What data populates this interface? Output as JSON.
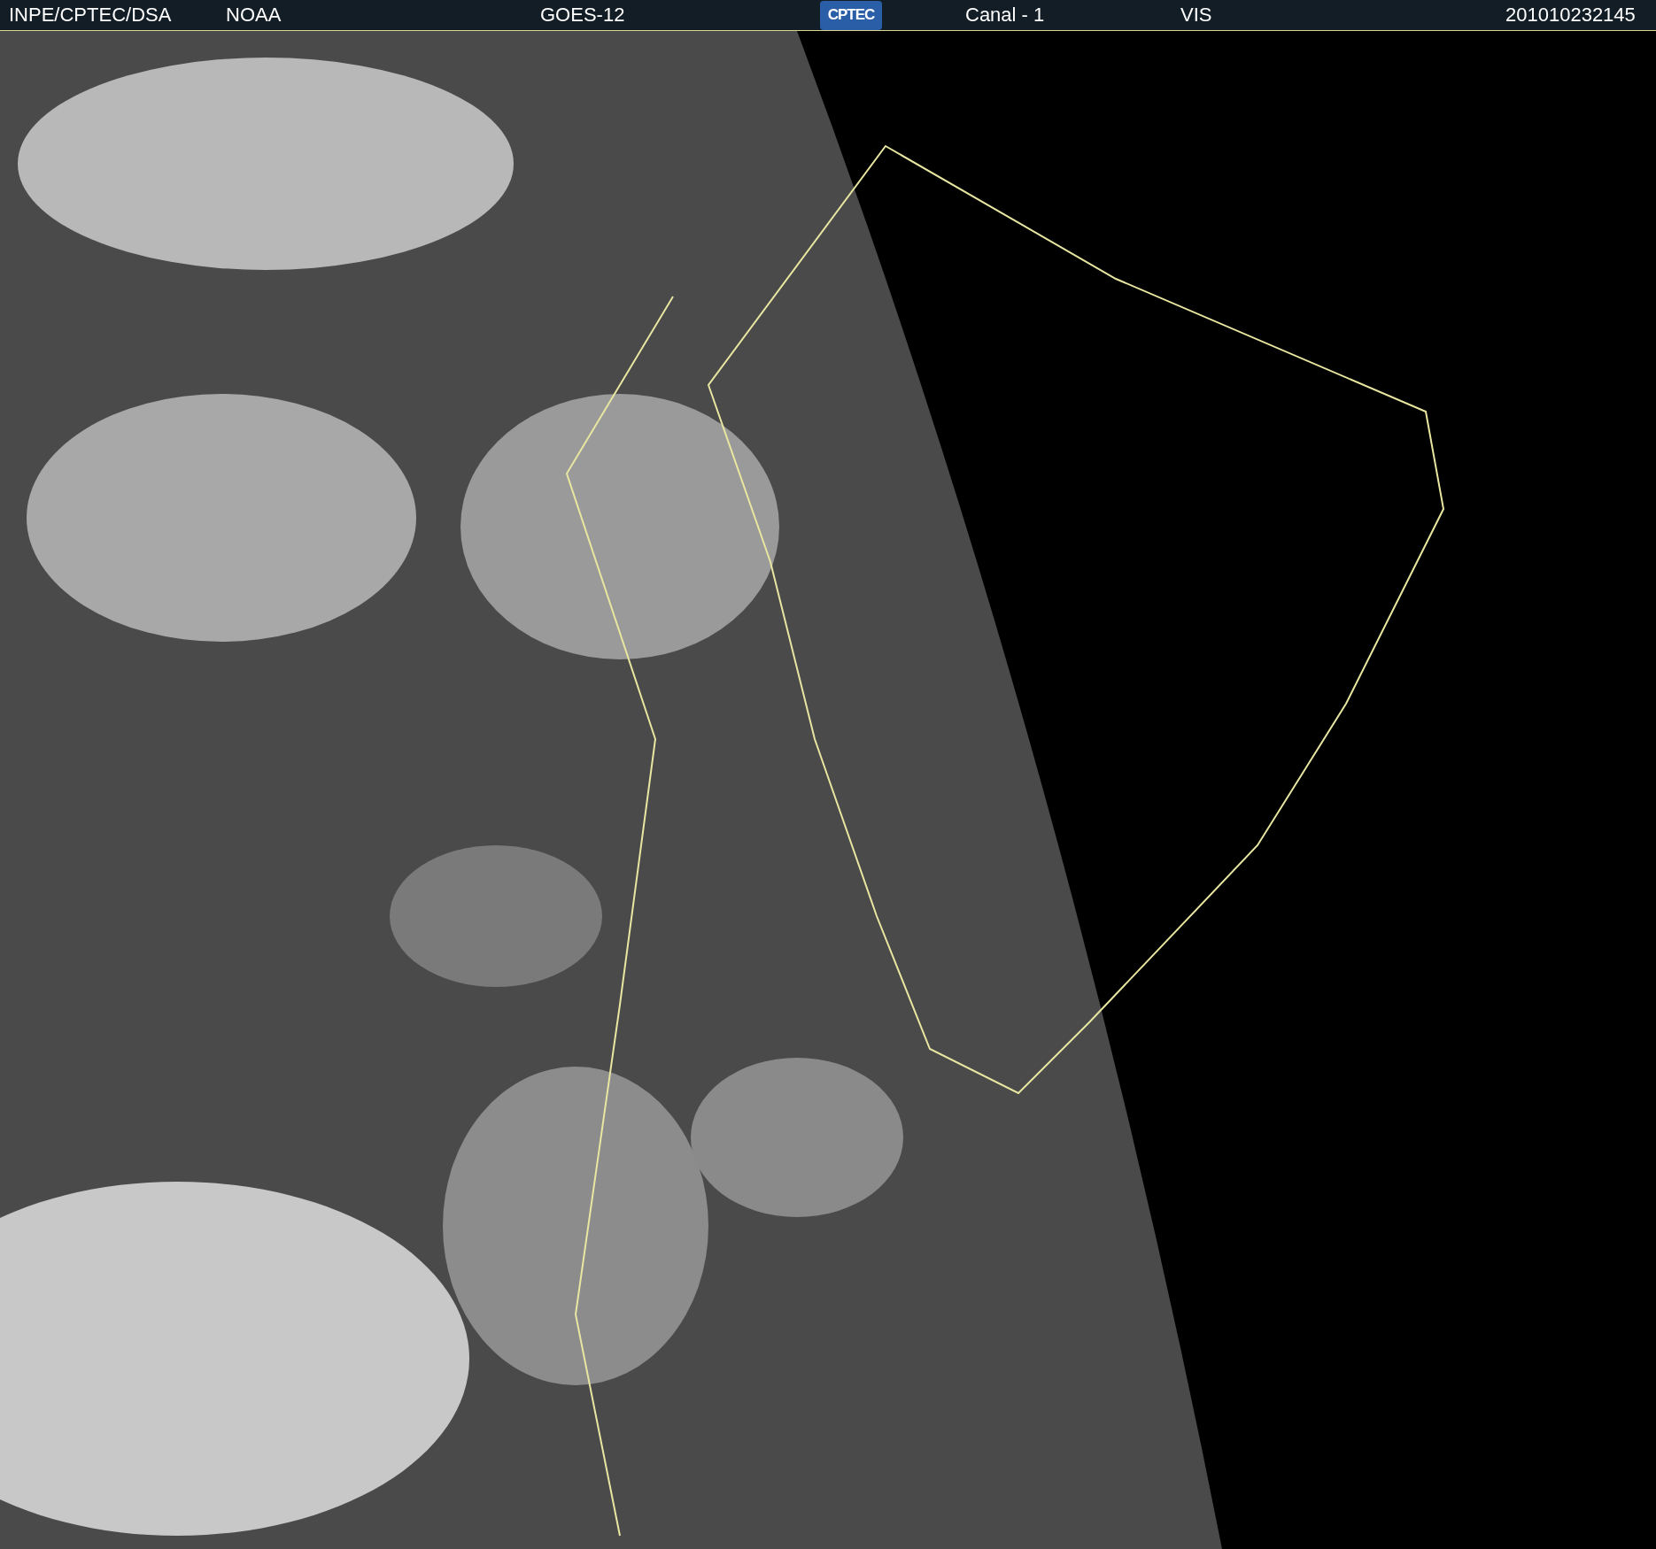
{
  "header": {
    "items": [
      {
        "kind": "text",
        "text": "INPE/CPTEC/DSA"
      },
      {
        "kind": "text",
        "text": "NOAA"
      },
      {
        "kind": "text",
        "text": "GOES-12"
      },
      {
        "kind": "logo",
        "text": "CPTEC"
      },
      {
        "kind": "text",
        "text": "Canal - 1"
      },
      {
        "kind": "text",
        "text": "VIS"
      },
      {
        "kind": "text",
        "text": "201010232145"
      }
    ]
  }
}
